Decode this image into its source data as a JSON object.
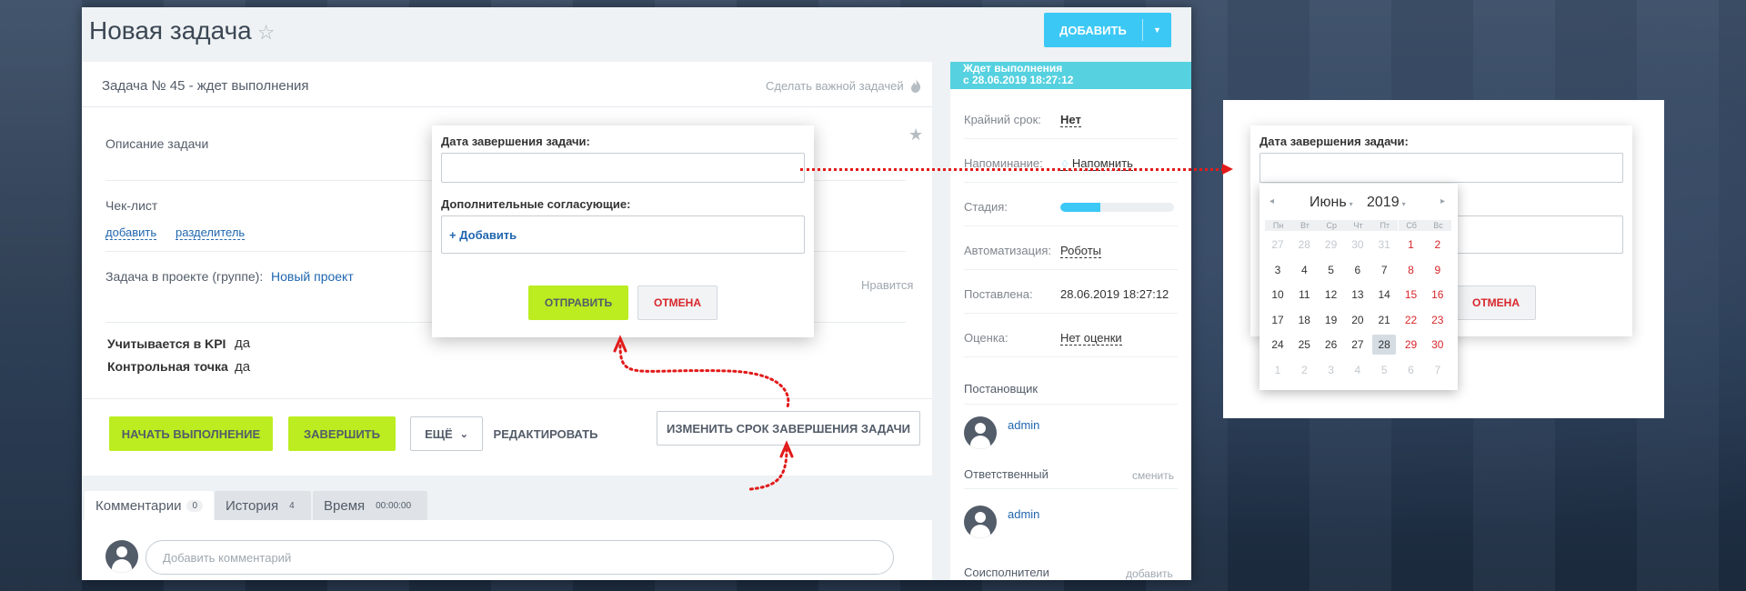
{
  "header": {
    "title": "Новая задача",
    "star": "☆",
    "add_button": "ДОБАВИТЬ"
  },
  "task": {
    "subtitle": "Задача № 45 - ждет выполнения",
    "make_important": "Сделать важной задачей",
    "description": "Описание задачи",
    "checklist": "Чек-лист",
    "add": "добавить",
    "separator": "разделитель",
    "project_label": "Задача в проекте (группе):",
    "project_value": "Новый проект",
    "likes": "Нравится",
    "kpi_label": "Учитывается в KPI",
    "kpi_value": "да",
    "checkpoint_label": "Контрольная точка",
    "checkpoint_value": "да"
  },
  "actions": {
    "start": "НАЧАТЬ ВЫПОЛНЕНИЕ",
    "finish": "ЗАВЕРШИТЬ",
    "more": "ЕЩЁ",
    "edit": "РЕДАКТИРОВАТЬ",
    "change_deadline": "ИЗМЕНИТЬ СРОК ЗАВЕРШЕНИЯ ЗАДАЧИ"
  },
  "tabs": [
    {
      "label": "Комментарии",
      "count": "0"
    },
    {
      "label": "История",
      "count": "4"
    },
    {
      "label": "Время",
      "count": "00:00:00"
    }
  ],
  "comment": {
    "placeholder": "Добавить комментарий"
  },
  "sidebar": {
    "status": "Ждет выполнения",
    "status_since": "с 28.06.2019 18:27:12",
    "deadline_label": "Крайний срок:",
    "deadline_value": "Нет",
    "reminder_label": "Напоминание:",
    "reminder_value": "Напомнить",
    "stage_label": "Стадия:",
    "stage_progress": 0.35,
    "automation_label": "Автоматизация:",
    "automation_value": "Роботы",
    "created_label": "Поставлена:",
    "created_value": "28.06.2019 18:27:12",
    "rating_label": "Оценка:",
    "rating_value": "Нет оценки",
    "creator_label": "Постановщик",
    "creator_name": "admin",
    "responsible_label": "Ответственный",
    "change": "сменить",
    "responsible_name": "admin",
    "coexec_label": "Соисполнители",
    "coexec_add": "добавить"
  },
  "popup": {
    "date_label": "Дата завершения задачи:",
    "approvers_label": "Дополнительные согласующие:",
    "add_approver": "+ Добавить",
    "submit": "ОТПРАВИТЬ",
    "cancel": "ОТМЕНА"
  },
  "calendar": {
    "month": "Июнь",
    "year": "2019",
    "weekdays": [
      "Пн",
      "Вт",
      "Ср",
      "Чт",
      "Пт",
      "Сб",
      "Вс"
    ],
    "weeks": [
      [
        "27",
        "28",
        "29",
        "30",
        "31",
        "1",
        "2"
      ],
      [
        "3",
        "4",
        "5",
        "6",
        "7",
        "8",
        "9"
      ],
      [
        "10",
        "11",
        "12",
        "13",
        "14",
        "15",
        "16"
      ],
      [
        "17",
        "18",
        "19",
        "20",
        "21",
        "22",
        "23"
      ],
      [
        "24",
        "25",
        "26",
        "27",
        "28",
        "29",
        "30"
      ],
      [
        "1",
        "2",
        "3",
        "4",
        "5",
        "6",
        "7"
      ]
    ],
    "selected_day": "28"
  },
  "colors": {
    "accent": "#3bc8f5",
    "green": "#bbed21",
    "status": "#56d1e0",
    "weekend": "#d8262b",
    "link": "#2067b0"
  }
}
